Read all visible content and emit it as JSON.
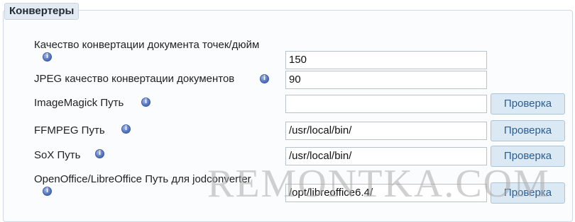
{
  "section": {
    "title": "Конвертеры"
  },
  "rows": [
    {
      "label": "Качество конвертации документа точек/дюйм",
      "value": "150",
      "button": null
    },
    {
      "label": "JPEG качество конвертации документов",
      "value": "90",
      "button": null
    },
    {
      "label": "ImageMagick Путь",
      "value": "",
      "button": "Проверка"
    },
    {
      "label": "FFMPEG Путь",
      "value": "/usr/local/bin/",
      "button": "Проверка"
    },
    {
      "label": "SoX Путь",
      "value": "/usr/local/bin/",
      "button": "Проверка"
    },
    {
      "label": "OpenOffice/LibreOffice Путь для jodconverter",
      "value": "/opt/libreoffice6.4/",
      "button": "Проверка"
    }
  ],
  "info_icon": "info-icon",
  "watermark": "REMONTKA.COM",
  "colors": {
    "legend_bg": "#e3eaf2",
    "button_bg": "#dbe9f5",
    "button_text": "#2a5d8f",
    "info_icon": "#4b6cb8"
  }
}
